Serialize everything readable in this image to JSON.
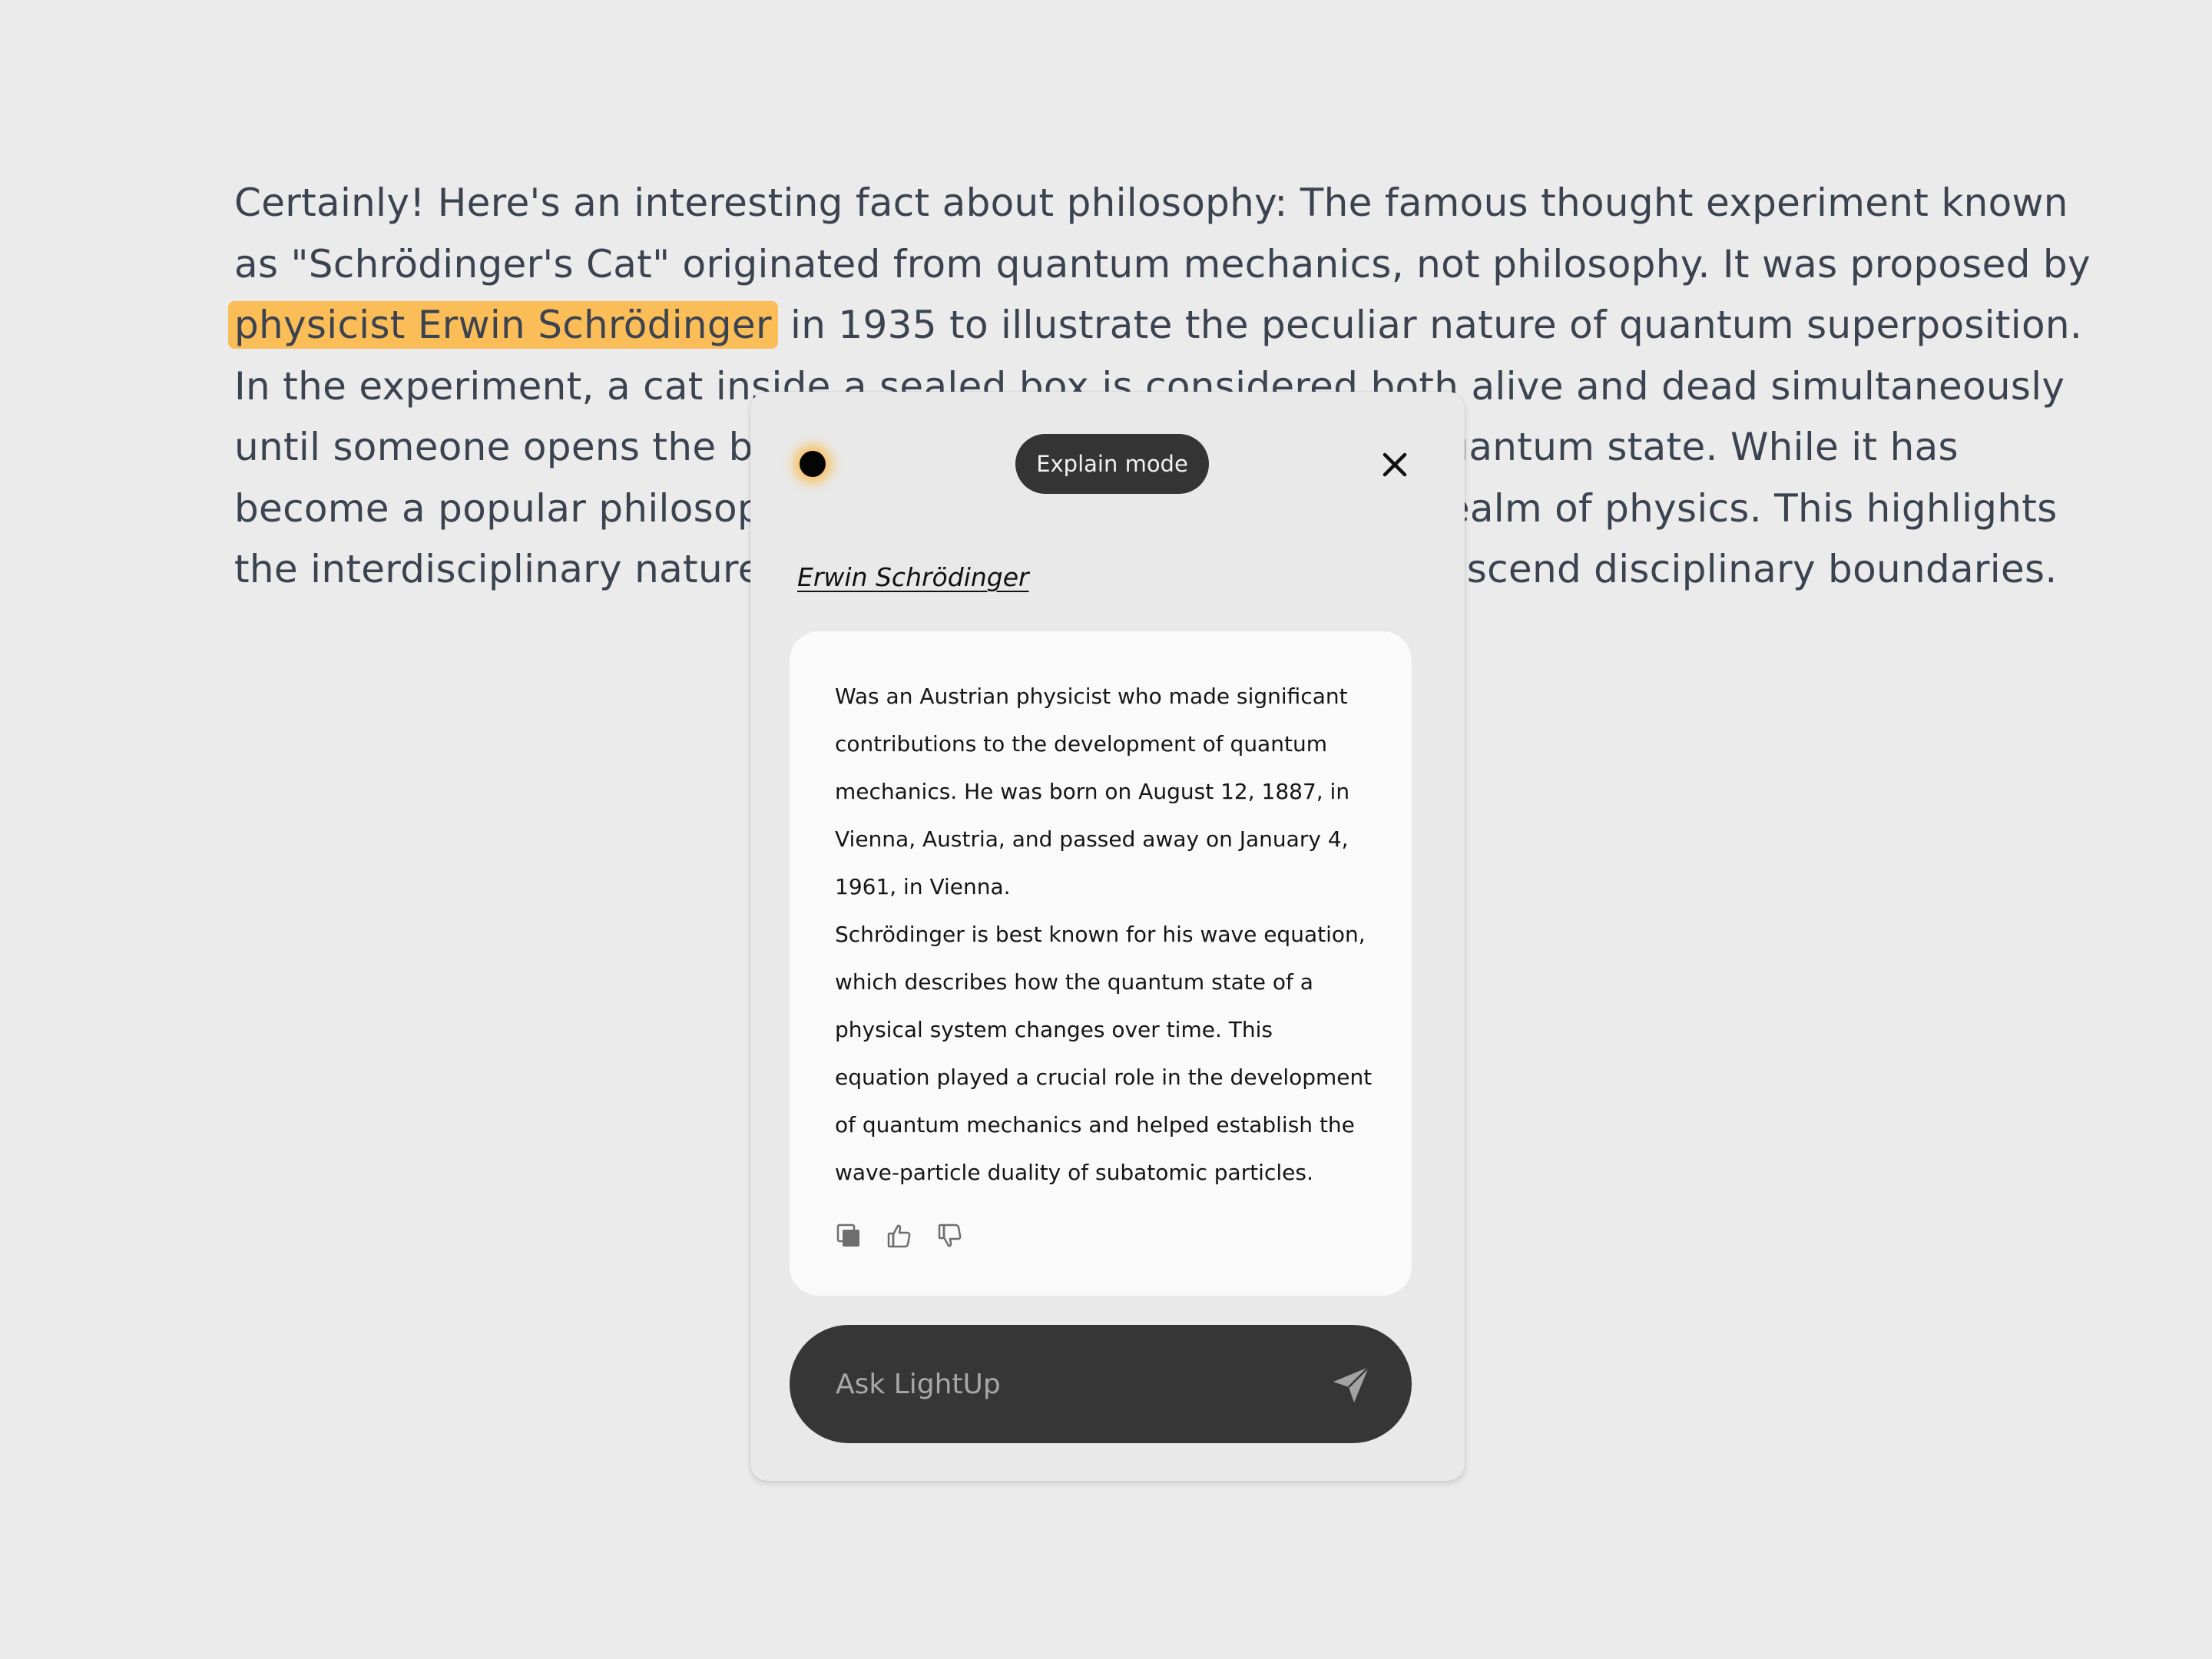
{
  "article": {
    "line1": "Certainly! Here's an interesting fact about philosophy: The famous thought experiment known",
    "line2": "as \"Schrödinger's Cat\" originated from quantum mechanics, not philosophy. It was proposed by",
    "line3_highlight": "physicist Erwin Schrödinger",
    "line3_rest": " in 1935 to illustrate the peculiar nature of quantum superposition.",
    "line4": "In the experiment, a cat inside a sealed box is considered both alive and dead simultaneously",
    "line5": "until someone opens the box and observes it, collapsing the quantum state. While it has",
    "line6": "become a popular philosophical example, it originated in the realm of physics. This highlights",
    "line7": "the interdisciplinary nature of ideas and how concepts can transcend disciplinary boundaries."
  },
  "popup": {
    "mode_label": "Explain mode",
    "term": "Erwin Schrödinger",
    "explanation_lines": [
      "Was an Austrian physicist who made significant",
      "contributions to the development of quantum",
      "mechanics. He was born on August 12, 1887, in",
      "Vienna, Austria, and passed away on January 4,",
      "1961, in Vienna.",
      "Schrödinger is best known for his wave equation,",
      "which describes how the quantum state of a",
      "physical system changes over time. This",
      "equation played a crucial role in the development",
      "of quantum mechanics and helped establish the",
      "wave-particle duality of subatomic particles."
    ],
    "ask_placeholder": "Ask LightUp",
    "icons": {
      "indicator": "status-dot-icon",
      "close": "close-icon",
      "copy": "copy-icon",
      "like": "thumbs-up-icon",
      "dislike": "thumbs-down-icon",
      "send": "send-icon"
    }
  },
  "colors": {
    "background": "#ebebeb",
    "article_text": "#3c4350",
    "highlight": "#fbbd58",
    "popup_bg": "#e9e9e9",
    "card_bg": "#fafafa",
    "dark": "#363636"
  }
}
